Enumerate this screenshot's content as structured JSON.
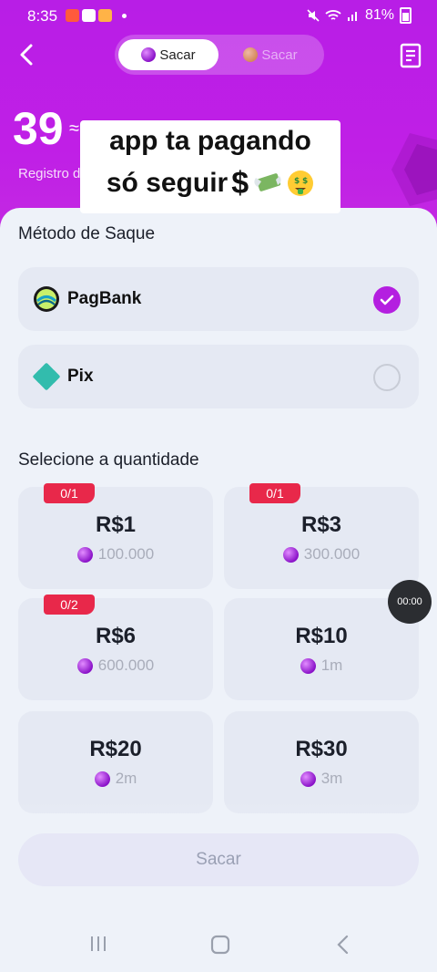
{
  "status_bar": {
    "time": "8:35",
    "battery": "81%"
  },
  "header": {
    "tab_active": "Sacar",
    "tab_inactive": "Sacar"
  },
  "balance": {
    "amount": "39",
    "approx_symbol": "≈",
    "registro_label": "Registro d"
  },
  "caption": {
    "line1": "app ta pagando",
    "line2": "só seguir",
    "dollar": "$"
  },
  "method_section": {
    "title": "Método de Saque",
    "methods": [
      {
        "name": "PagBank",
        "selected": true
      },
      {
        "name": "Pix",
        "selected": false
      }
    ]
  },
  "amount_section": {
    "title": "Selecione a quantidade",
    "options": [
      {
        "value": "R$1",
        "coins": "100.000",
        "badge": "0/1"
      },
      {
        "value": "R$3",
        "coins": "300.000",
        "badge": "0/1"
      },
      {
        "value": "R$6",
        "coins": "600.000",
        "badge": "0/2"
      },
      {
        "value": "R$10",
        "coins": "1m",
        "badge": ""
      },
      {
        "value": "R$20",
        "coins": "2m",
        "badge": ""
      },
      {
        "value": "R$30",
        "coins": "3m",
        "badge": ""
      }
    ]
  },
  "timer": "00:00",
  "submit_label": "Sacar",
  "colors": {
    "accent": "#b41fe0",
    "badge": "#e8284a",
    "header_bg": "#c01fe6"
  }
}
